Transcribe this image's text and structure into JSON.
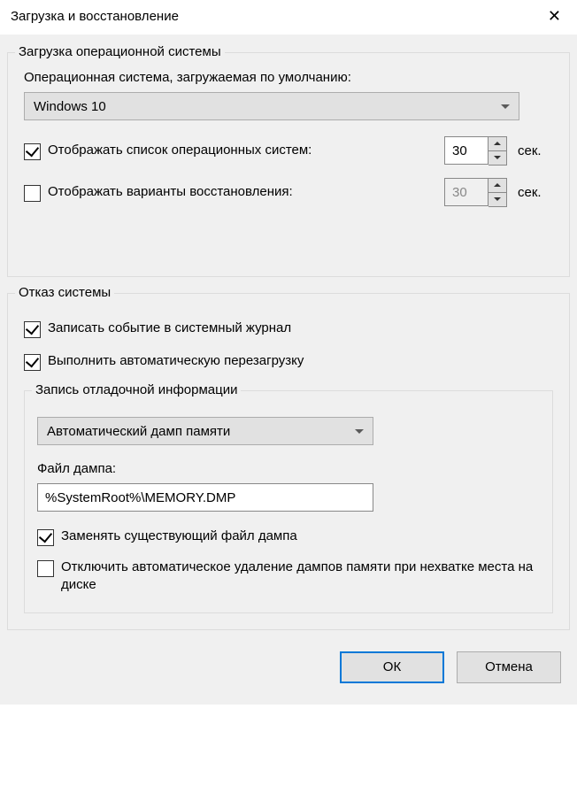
{
  "window": {
    "title": "Загрузка и восстановление"
  },
  "startup": {
    "group_title": "Загрузка операционной системы",
    "default_os_label": "Операционная система, загружаемая по умолчанию:",
    "default_os_value": "Windows 10",
    "show_os_list_label": "Отображать список операционных систем:",
    "show_os_list_checked": true,
    "show_os_list_seconds": "30",
    "show_recovery_label": "Отображать варианты восстановления:",
    "show_recovery_checked": false,
    "show_recovery_seconds": "30",
    "seconds_suffix": "сек."
  },
  "failure": {
    "group_title": "Отказ системы",
    "log_event_label": "Записать событие в системный журнал",
    "log_event_checked": true,
    "auto_restart_label": "Выполнить автоматическую перезагрузку",
    "auto_restart_checked": true,
    "debug_group_title": "Запись отладочной информации",
    "dump_type_value": "Автоматический дамп памяти",
    "dump_file_label": "Файл дампа:",
    "dump_file_value": "%SystemRoot%\\MEMORY.DMP",
    "overwrite_label": "Заменять существующий файл дампа",
    "overwrite_checked": true,
    "disable_auto_delete_label": "Отключить автоматическое удаление дампов памяти при нехватке места на диске",
    "disable_auto_delete_checked": false
  },
  "buttons": {
    "ok": "ОК",
    "cancel": "Отмена"
  }
}
